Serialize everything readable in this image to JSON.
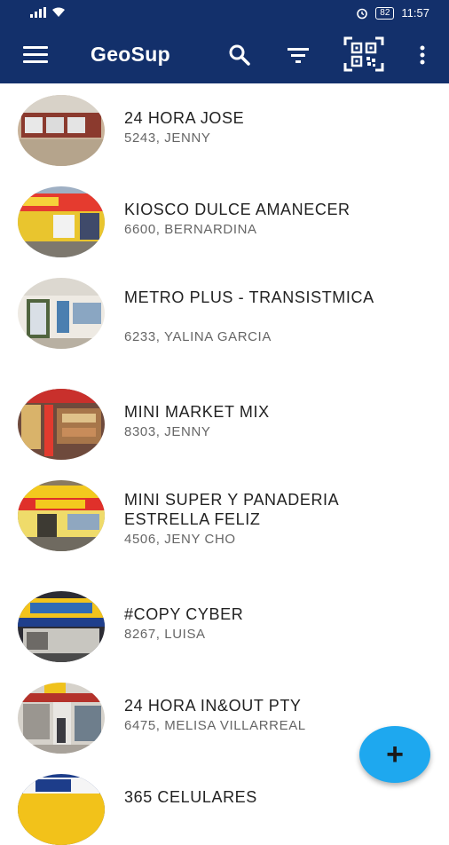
{
  "status_bar": {
    "battery": "82",
    "time": "11:57"
  },
  "app_bar": {
    "title": "GeoSup",
    "icons": [
      "menu-icon",
      "search-icon",
      "filter-icon",
      "qr-code-icon",
      "more-vert-icon"
    ]
  },
  "stores": [
    {
      "name": " 24 HORA JOSE",
      "subtitle": "5243, JENNY"
    },
    {
      "name": " KIOSCO DULCE AMANECER",
      "subtitle": "6600, BERNARDINA"
    },
    {
      "name": " METRO PLUS - TRANSISTMICA",
      "subtitle": "6233, YALINA GARCIA"
    },
    {
      "name": " MINI MARKET MIX",
      "subtitle": "8303, JENNY"
    },
    {
      "name": " MINI SUPER Y PANADERIA ESTRELLA FELIZ",
      "subtitle": "4506, JENY CHO"
    },
    {
      "name": "#COPY CYBER",
      "subtitle": "8267, LUISA"
    },
    {
      "name": "24 HORA IN&OUT PTY",
      "subtitle": "6475, MELISA VILLARREAL"
    },
    {
      "name": "365 CELULARES",
      "subtitle": ""
    }
  ],
  "fab": {
    "label": "+",
    "icon": "add-icon"
  },
  "colors": {
    "primary": "#13306b",
    "accent": "#1ea8ef"
  }
}
